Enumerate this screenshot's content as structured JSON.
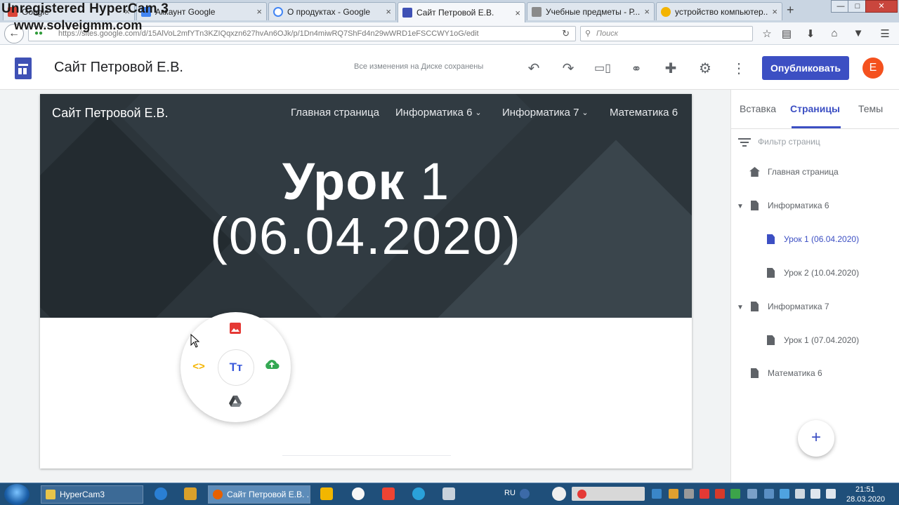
{
  "watermark": {
    "line1": "Unregistered HyperCam 3",
    "line2": "www.solveigmm.com"
  },
  "browser": {
    "tabs": [
      {
        "label": "Google",
        "fav_color": "#db4437"
      },
      {
        "label": "Аккаунт Google",
        "fav_color": "#4285f4"
      },
      {
        "label": "О продуктах - Google",
        "fav_color": "#4285f4"
      },
      {
        "label": "Сайт Петровой Е.В.",
        "fav_color": "#3f51b5",
        "active": true
      },
      {
        "label": "Учебные предметы - Р...",
        "fav_color": "#8a8a8a"
      },
      {
        "label": "устройство компьютер...",
        "fav_color": "#f4b400"
      }
    ],
    "tab_close": "×",
    "new_tab": "+",
    "window_buttons": {
      "minimize": "—",
      "maximize": "□",
      "close": "✕"
    },
    "url": "https://sites.google.com/d/15AlVoL2mfYTn3KZIQqxzn627hvAn6OJk/p/1Dn4miwRQ7ShFd4n29wWRD1eFSCCWY1oG/edit",
    "search_placeholder": "Поиск",
    "icons": [
      "bookmark-star-icon",
      "reading-list-icon",
      "download-icon",
      "home-icon",
      "pocket-icon",
      "menu-icon"
    ]
  },
  "app": {
    "site_title": "Сайт Петровой Е.В.",
    "saved_status": "Все изменения на Диске сохранены",
    "publish_label": "Опубликовать",
    "avatar_letter": "E",
    "tools": [
      "undo-icon",
      "redo-icon",
      "preview-icon",
      "link-icon",
      "share-icon",
      "settings-icon",
      "more-icon"
    ]
  },
  "page": {
    "site_name": "Сайт Петровой Е.В.",
    "menu": [
      {
        "label": "Главная страница",
        "dropdown": false
      },
      {
        "label": "Информатика 6",
        "dropdown": true
      },
      {
        "label": "Информатика 7",
        "dropdown": true
      },
      {
        "label": "Математика 6",
        "dropdown": false
      }
    ],
    "heading_bold": "Урок",
    "heading_num": "1",
    "heading_date": "(06.04.2020)",
    "radial_center": "Tт"
  },
  "panel": {
    "tabs": [
      "Вставка",
      "Страницы",
      "Темы"
    ],
    "active_tab": "Страницы",
    "filter_placeholder": "Фильтр страниц",
    "pages": [
      {
        "label": "Главная страница",
        "type": "home",
        "level": 0
      },
      {
        "label": "Информатика 6",
        "type": "doc",
        "level": 0,
        "expanded": true
      },
      {
        "label": "Урок 1 (06.04.2020)",
        "type": "doc",
        "level": 1,
        "selected": true
      },
      {
        "label": "Урок 2 (10.04.2020)",
        "type": "doc",
        "level": 1
      },
      {
        "label": "Информатика 7",
        "type": "doc",
        "level": 0,
        "expanded": true
      },
      {
        "label": "Урок 1 (07.04.2020)",
        "type": "doc",
        "level": 1
      },
      {
        "label": "Математика 6",
        "type": "doc",
        "level": 0
      }
    ],
    "add_label": "+"
  },
  "taskbar": {
    "items": [
      {
        "label": "HyperCam3",
        "icon_color": "#e8c44a"
      },
      {
        "label": "Сайт Петровой Е.В. ...",
        "icon_color": "#e66000",
        "active": true
      }
    ],
    "lang": "RU",
    "time": "21:51",
    "date": "28.03.2020"
  }
}
